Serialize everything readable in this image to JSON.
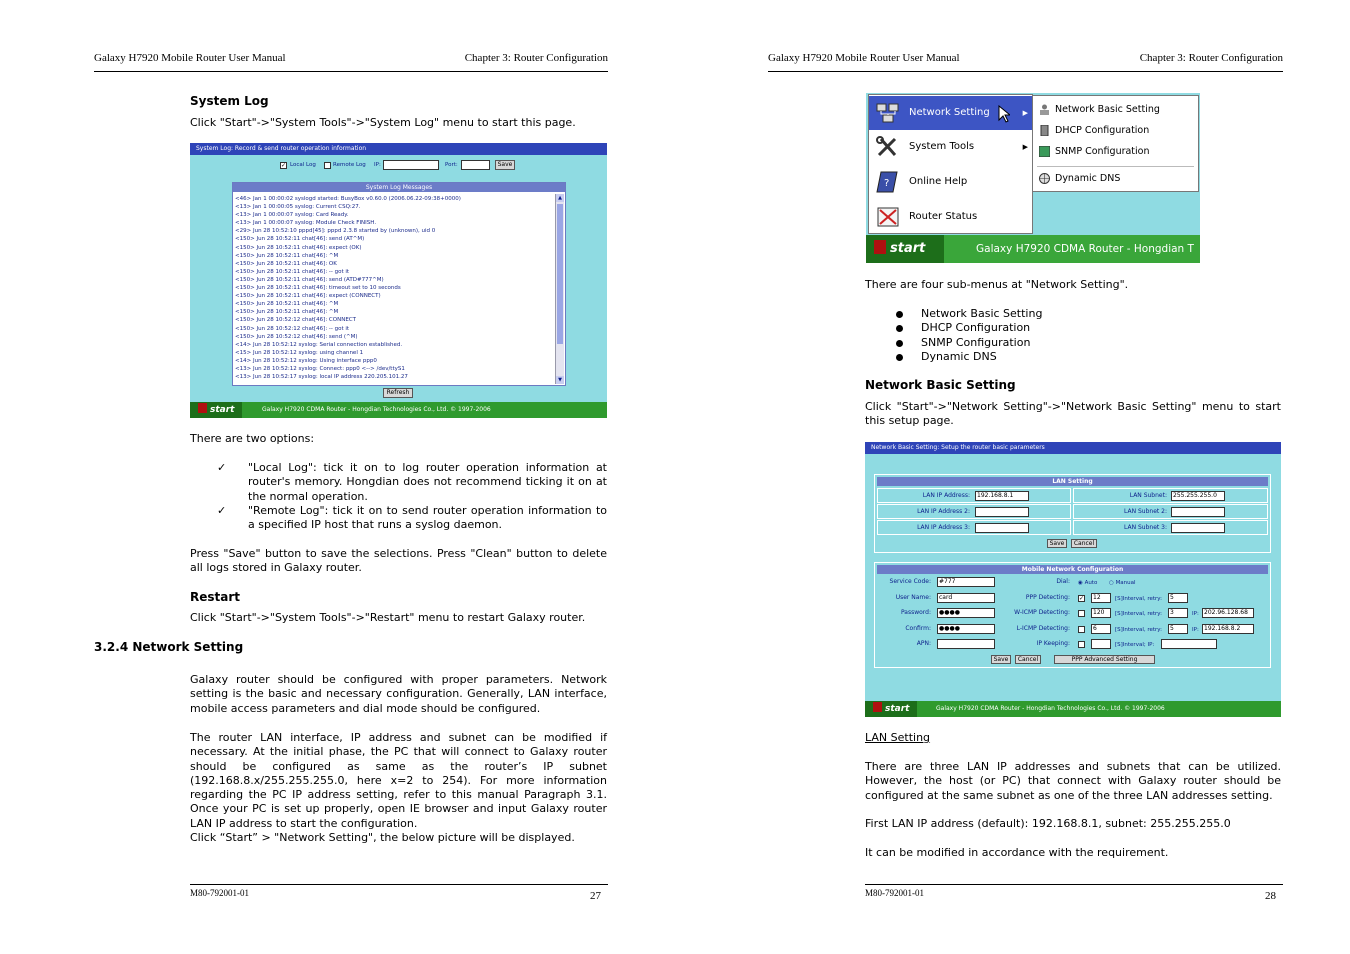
{
  "left_page": {
    "header_left": "Galaxy H7920 Mobile Router User Manual",
    "header_right": "Chapter 3: Router Configuration",
    "system_log_heading": "System Log",
    "system_log_intro": "Click \"Start\"->\"System Tools\"->\"System Log\" menu to start this page.",
    "syslog_shot": {
      "title": "System Log: Record & send router operation information",
      "local_log_label": "Local Log",
      "remote_log_label": "Remote Log",
      "ip_label": "IP:",
      "port_label": "Port:",
      "save_button": "Save",
      "messages_title": "System Log Messages",
      "log_lines": [
        "<46> Jan 1 00:00:02 syslogd started: BusyBox v0.60.0 (2006.06.22-09:38+0000)",
        "<13> Jan 1 00:00:05 syslog: Current CSQ:27.",
        "<13> Jan 1 00:00:07 syslog: Card Ready.",
        "<13> Jan 1 00:00:07 syslog: Module Check FINISH.",
        "<29> Jun 28 10:52:10 pppd[45]: pppd 2.3.8 started by (unknown), uid 0",
        "<150> Jun 28 10:52:11 chat[46]: send (AT^M)",
        "<150> Jun 28 10:52:11 chat[46]: expect (OK)",
        "<150> Jun 28 10:52:11 chat[46]: ^M",
        "<150> Jun 28 10:52:11 chat[46]: OK",
        "<150> Jun 28 10:52:11 chat[46]: -- got it",
        "<150> Jun 28 10:52:11 chat[46]: send (ATD#777^M)",
        "<150> Jun 28 10:52:11 chat[46]: timeout set to 10 seconds",
        "<150> Jun 28 10:52:11 chat[46]: expect (CONNECT)",
        "<150> Jun 28 10:52:11 chat[46]: ^M",
        "<150> Jun 28 10:52:11 chat[46]: ^M",
        "<150> Jun 28 10:52:12 chat[46]: CONNECT",
        "<150> Jun 28 10:52:12 chat[46]: -- got it",
        "<150> Jun 28 10:52:12 chat[46]: send (^M)",
        "<14> Jun 28 10:52:12 syslog: Serial connection established.",
        "<15> Jun 28 10:52:12 syslog: using channel 1",
        "<14> Jun 28 10:52:12 syslog: Using interface ppp0",
        "<13> Jun 28 10:52:12 syslog: Connect: ppp0 <--> /dev/ttyS1",
        "<13> Jun 28 10:52:17 syslog: local IP address 220.205.101.27"
      ],
      "refresh_button": "Refresh",
      "start_label": "start",
      "footer": "Galaxy H7920 CDMA Router - Hongdian Technologies Co., Ltd. © 1997-2006"
    },
    "options_intro": "There are two options:",
    "options": [
      "\"Local Log\": tick it on to log router operation information at router's memory. Hongdian does not recommend ticking it on at the normal operation.",
      "\"Remote Log\": tick it on to send router operation information to a specified IP host that runs a syslog daemon."
    ],
    "save_clean_text": "Press \"Save\" button to save the selections. Press \"Clean\" button to delete all logs stored in Galaxy router.",
    "restart_heading": "Restart",
    "restart_text": "Click \"Start\"->\"System Tools\"->\"Restart\" menu to restart Galaxy router.",
    "section_heading": "3.2.4 Network Setting",
    "para1": "Galaxy router should be configured with proper parameters. Network setting is the basic and necessary configuration. Generally, LAN interface, mobile access parameters and dial mode should be configured.",
    "para2": "The router LAN interface, IP address and subnet can be modified if necessary. At the initial phase, the PC that will connect to Galaxy router should be configured as same as the router’s IP subnet (192.168.8.x/255.255.255.0, here x=2 to 254). For more information regarding the PC IP address setting, refer to this manual Paragraph 3.1. Once your PC is set up properly, open IE browser and input Galaxy router LAN IP address to start the configuration.",
    "para3": "Click “Start” > \"Network Setting\", the below picture will be displayed.",
    "footer_code": "M80-792001-01",
    "page_number": "27"
  },
  "right_page": {
    "header_left": "Galaxy H7920 Mobile Router User Manual",
    "header_right": "Chapter 3: Router Configuration",
    "menu_shot": {
      "main_items": [
        "Network Setting",
        "System Tools",
        "Online Help",
        "Router Status"
      ],
      "sub_items": [
        "Network Basic Setting",
        "DHCP Configuration",
        "SNMP Configuration",
        "Dynamic DNS"
      ],
      "start_label": "start",
      "taskbar_text": "Galaxy H7920 CDMA Router - Hongdian T"
    },
    "submenus_intro": "There are four sub-menus at \"Network Setting\".",
    "submenus": [
      "Network Basic Setting",
      "DHCP Configuration",
      "SNMP Configuration",
      "Dynamic DNS"
    ],
    "nbs_heading": "Network Basic Setting",
    "nbs_intro": "Click \"Start\"->\"Network Setting\"->\"Network Basic Setting\" menu to start this setup page.",
    "nbs_shot": {
      "title": "Network Basic Setting: Setup the router basic parameters",
      "lan_title": "LAN Setting",
      "lan_ip1_label": "LAN IP Address:",
      "lan_ip1_value": "192.168.8.1",
      "lan_ip2_label": "LAN IP Address 2:",
      "lan_ip3_label": "LAN IP Address 3:",
      "lan_sub1_label": "LAN Subnet:",
      "lan_sub1_value": "255.255.255.0",
      "lan_sub2_label": "LAN Subnet 2:",
      "lan_sub3_label": "LAN Subnet 3:",
      "save": "Save",
      "cancel": "Cancel",
      "mobile_title": "Mobile Network Configuration",
      "service_code_label": "Service Code:",
      "service_code_value": "#777",
      "user_name_label": "User Name:",
      "user_name_value": "card",
      "password_label": "Password:",
      "password_value": "●●●●",
      "confirm_label": "Confirm:",
      "confirm_value": "●●●●",
      "apn_label": "APN:",
      "dial_label": "Dial:",
      "dial_auto": "Auto",
      "dial_manual": "Manual",
      "ppp_label": "PPP Detecting:",
      "ppp_interval": "12",
      "ppp_retry": "5",
      "wicmp_label": "W-ICMP Detecting:",
      "wicmp_interval": "120",
      "wicmp_retry": "3",
      "wicmp_ip": "202.96.128.68",
      "licmp_label": "L-ICMP Detecting:",
      "licmp_interval": "6",
      "licmp_retry": "5",
      "licmp_ip": "192.168.8.2",
      "ip_keeping_label": "IP Keeping:",
      "interval_retry": "[S]Interval, retry:",
      "ip_label": "IP:",
      "interval_ip": "[S]Interval; IP:",
      "ppp_advanced": "PPP Advanced Setting",
      "start_label": "start",
      "footer": "Galaxy H7920 CDMA Router - Hongdian Technologies Co., Ltd. © 1997-2006"
    },
    "lan_setting_heading": "LAN Setting",
    "lan_text": "There are three LAN IP addresses and subnets that can be utilized. However, the host (or PC) that connect with Galaxy router should be configured at the same subnet as one of the three LAN addresses setting.",
    "first_lan": "First LAN IP address (default): 192.168.8.1, subnet: 255.255.255.0",
    "modify_text": "It can be modified in accordance with the requirement.",
    "footer_code": "M80-792001-01",
    "page_number": "28"
  },
  "colors": {
    "screen_bg": "#8fdbe2",
    "title_bar": "#2e44b8",
    "status_bar": "#2f9a2e"
  }
}
